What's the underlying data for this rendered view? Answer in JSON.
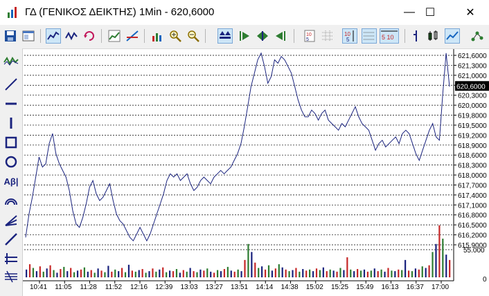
{
  "window": {
    "title": "ΓΔ (ΓΕΝΙΚΟΣ ΔΕΙΚΤΗΣ) 1Min - 620,6000",
    "minimize_glyph": "—",
    "maximize_glyph": "☐",
    "close_glyph": "✕"
  },
  "toolbar": {
    "icons": [
      "save-icon",
      "properties-icon",
      "line-chart-icon",
      "ohlc-icon",
      "refresh-icon",
      "indicator-icon",
      "trendline-icon",
      "volume-icon",
      "zoom-in-icon",
      "zoom-out-icon",
      "fit-icon",
      "scroll-right-icon",
      "scroll-both-icon",
      "scroll-left-icon",
      "data-window-icon",
      "grid-icon",
      "price-scale-icon",
      "time-scale-icon",
      "bar-type-icon",
      "candle-type-icon",
      "line-type-icon",
      "network-icon"
    ],
    "price_scale_text": "5 10"
  },
  "left_toolbar": {
    "icons": [
      "indicator-wave-icon",
      "line-tool-icon",
      "horizontal-line-icon",
      "vertical-line-icon",
      "rectangle-icon",
      "ellipse-icon",
      "text-tool-icon",
      "arc-icon",
      "fan-icon",
      "channel-icon",
      "fibonacci-icon",
      "grid-lines-icon"
    ],
    "text_tool_label": "Aβ|"
  },
  "chart_data": {
    "type": "line",
    "price_ticks": [
      "621,6000",
      "621,3000",
      "621,0000",
      "620,6000",
      "620,3000",
      "620,0000",
      "619,8000",
      "619,5000",
      "619,2000",
      "618,9000",
      "618,6000",
      "618,3000",
      "618,0000",
      "617,7000",
      "617,4000",
      "617,1000",
      "616,8000",
      "616,5000",
      "616,2000",
      "615,9000"
    ],
    "time_ticks": [
      "10:41",
      "11:05",
      "11:28",
      "11:52",
      "12:16",
      "12:39",
      "13:03",
      "13:27",
      "13:51",
      "14:14",
      "14:38",
      "15:02",
      "15:25",
      "15:49",
      "16:13",
      "16:37",
      "17:00"
    ],
    "volume_ticks": [
      "55.000",
      "0"
    ],
    "last_price_label": "620,6000",
    "last_price": 620.6,
    "price_range": [
      615.88,
      621.72
    ],
    "volume_max": 55000,
    "price_series": [
      616.1,
      616.8,
      617.3,
      617.9,
      618.5,
      618.2,
      618.3,
      618.9,
      619.2,
      618.6,
      618.3,
      618.1,
      617.9,
      617.5,
      616.9,
      616.5,
      616.4,
      616.7,
      617.1,
      617.6,
      617.8,
      617.4,
      617.2,
      617.3,
      617.5,
      617.7,
      617.2,
      616.8,
      616.6,
      616.5,
      616.3,
      616.1,
      616.0,
      616.2,
      616.4,
      616.2,
      616.0,
      616.2,
      616.5,
      616.8,
      617.1,
      617.4,
      617.8,
      618.0,
      617.9,
      618.0,
      617.8,
      617.9,
      618.0,
      617.7,
      617.5,
      617.6,
      617.8,
      617.9,
      617.8,
      617.7,
      617.9,
      618.0,
      618.1,
      618.0,
      618.1,
      618.2,
      618.4,
      618.6,
      618.9,
      619.4,
      620.0,
      620.6,
      621.0,
      621.4,
      621.6,
      621.2,
      620.7,
      620.9,
      621.4,
      621.3,
      621.5,
      621.4,
      621.2,
      621.0,
      620.6,
      620.2,
      619.9,
      619.7,
      619.7,
      619.9,
      619.8,
      619.6,
      619.8,
      619.9,
      619.6,
      619.5,
      619.4,
      619.3,
      619.5,
      619.4,
      619.6,
      619.8,
      620.0,
      619.7,
      619.5,
      619.4,
      619.3,
      619.0,
      618.7,
      618.9,
      619.0,
      618.8,
      618.9,
      619.0,
      619.1,
      618.9,
      619.2,
      619.3,
      619.2,
      618.9,
      618.6,
      618.4,
      618.7,
      619.0,
      619.3,
      619.5,
      619.1,
      619.0,
      620.4,
      621.6,
      620.6
    ],
    "volume_series": [
      12000,
      22000,
      15000,
      9000,
      18000,
      8000,
      14000,
      20000,
      11000,
      6000,
      13000,
      17000,
      9000,
      15000,
      7000,
      10000,
      12000,
      16000,
      8000,
      11000,
      6000,
      14000,
      10000,
      7000,
      19000,
      8000,
      12000,
      9000,
      15000,
      7000,
      21000,
      10000,
      8000,
      11000,
      13000,
      6000,
      9000,
      14000,
      8000,
      12000,
      16000,
      7000,
      10000,
      9000,
      13000,
      6000,
      11000,
      8000,
      15000,
      9000,
      7000,
      12000,
      10000,
      14000,
      8000,
      6000,
      11000,
      9000,
      13000,
      17000,
      10000,
      8000,
      12000,
      9000,
      30000,
      60000,
      45000,
      25000,
      15000,
      18000,
      12000,
      20000,
      10000,
      14000,
      22000,
      16000,
      12000,
      9000,
      11000,
      15000,
      8000,
      13000,
      10000,
      12000,
      9000,
      14000,
      11000,
      16000,
      9000,
      12000,
      10000,
      8000,
      15000,
      11000,
      35000,
      12000,
      9000,
      13000,
      10000,
      12000,
      8000,
      10000,
      14000,
      9000,
      12000,
      8000,
      15000,
      10000,
      9000,
      12000,
      11000,
      30000,
      10000,
      9000,
      14000,
      12000,
      18000,
      15000,
      20000,
      45000,
      60000,
      95000,
      70000,
      40000,
      30000
    ]
  }
}
